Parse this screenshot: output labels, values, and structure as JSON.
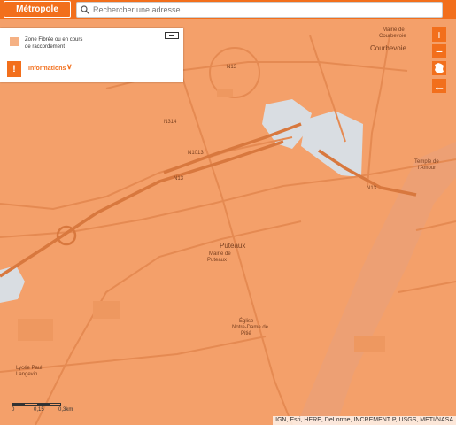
{
  "header": {
    "metro_label": "Métropole",
    "search_placeholder": "Rechercher une adresse..."
  },
  "legend": {
    "zone_label_line1": "Zone Fibrée ou en cours",
    "zone_label_line2": "de raccordement",
    "info_label": "Informations",
    "zone_color": "#f5b184"
  },
  "controls": {
    "zoom_in": "+",
    "zoom_out": "−",
    "home_icon": "france-map-icon",
    "back": "←"
  },
  "scale": {
    "t0": "0",
    "t1": "0,15",
    "t2": "0,3km"
  },
  "attribution": "IGN, Esri, HERE, DeLorme, INCREMENT P, USGS, METI/NASA",
  "place_labels": {
    "puteaux": "Puteaux",
    "mairie_puteaux": "Mairie de",
    "mairie_puteaux2": "Puteaux",
    "courbevoie": "Courbevoie",
    "mairie_courbevoie": "Mairie de",
    "mairie_courbevoie2": "Courbevoie",
    "temple": "Temple de",
    "temple2": "l'Amour",
    "eglise": "Église",
    "eglise2": "Notre-Dame de",
    "eglise3": "Pitié",
    "lycee": "Lycée Paul",
    "lycee2": "Langevin",
    "n13": "N13",
    "n314": "N314",
    "n1013": "N1013",
    "n13b": "N13",
    "n13c": "N13"
  },
  "colors": {
    "fiber_fill": "#f4a06a",
    "roads": "#e58a52",
    "major_roads": "#d8783e",
    "river": "#e8976a",
    "unserved": "#d9dde2",
    "accent": "#f26f1c"
  }
}
